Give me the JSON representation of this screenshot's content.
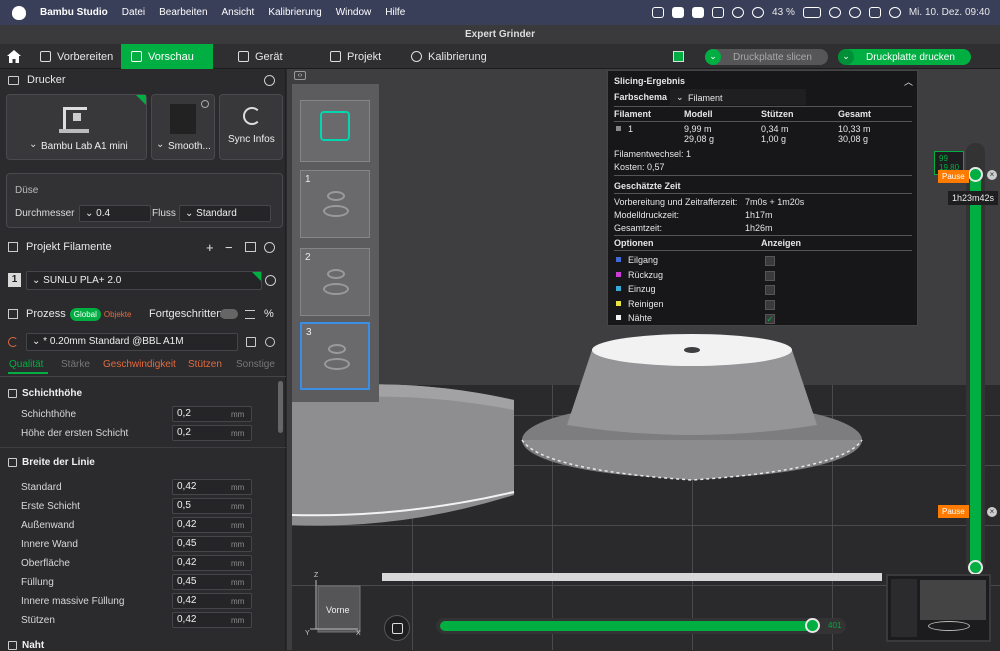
{
  "menubar": {
    "app": "Bambu Studio",
    "items": [
      "Datei",
      "Bearbeiten",
      "Ansicht",
      "Kalibrierung",
      "Window",
      "Hilfe"
    ],
    "battery": "43 %",
    "datetime": "Mi. 10. Dez.  09:40"
  },
  "window_title": "Expert Grinder",
  "nav": {
    "tabs": [
      "Vorbereiten",
      "Vorschau",
      "Gerät",
      "Projekt",
      "Kalibrierung"
    ],
    "active_tab": "Vorschau",
    "slice_button": "Druckplatte slicen",
    "print_button": "Druckplatte drucken"
  },
  "printer": {
    "section_title": "Drucker",
    "printer_name": "Bambu Lab A1 mini",
    "plate_name": "Smooth...",
    "sync_label": "Sync Infos",
    "nozzle_title": "Düse",
    "diameter_label": "Durchmesser",
    "diameter_value": "0.4",
    "flow_label": "Fluss",
    "flow_value": "Standard"
  },
  "filament": {
    "section_title": "Projekt Filamente",
    "slot": "1",
    "name": "SUNLU PLA+ 2.0"
  },
  "process": {
    "title": "Prozess",
    "badge_global": "Global",
    "badge_objects": "Objekte",
    "advanced_label": "Fortgeschritten",
    "preset": "* 0.20mm Standard @BBL A1M",
    "tabs": [
      "Qualität",
      "Stärke",
      "Geschwindigkeit",
      "Stützen",
      "Sonstige"
    ],
    "layer_height_title": "Schichthöhe",
    "layer_rows": [
      {
        "label": "Schichthöhe",
        "value": "0,2",
        "unit": "mm"
      },
      {
        "label": "Höhe der ersten Schicht",
        "value": "0,2",
        "unit": "mm"
      }
    ],
    "line_width_title": "Breite der Linie",
    "line_rows": [
      {
        "label": "Standard",
        "value": "0,42",
        "unit": "mm"
      },
      {
        "label": "Erste Schicht",
        "value": "0,5",
        "unit": "mm"
      },
      {
        "label": "Außenwand",
        "value": "0,42",
        "unit": "mm"
      },
      {
        "label": "Innere Wand",
        "value": "0,45",
        "unit": "mm"
      },
      {
        "label": "Oberfläche",
        "value": "0,42",
        "unit": "mm"
      },
      {
        "label": "Füllung",
        "value": "0,45",
        "unit": "mm"
      },
      {
        "label": "Innere massive Füllung",
        "value": "0,42",
        "unit": "mm"
      },
      {
        "label": "Stützen",
        "value": "0,42",
        "unit": "mm"
      }
    ],
    "seam_title": "Naht"
  },
  "thumbs": [
    "1",
    "2",
    "3"
  ],
  "result": {
    "title": "Slicing-Ergebnis",
    "color_scheme_label": "Farbschema",
    "color_scheme_value": "Filament",
    "headers": [
      "Filament",
      "Modell",
      "Stützen",
      "Gesamt"
    ],
    "row": {
      "id": "1",
      "model_m": "9,99 m",
      "model_g": "29,08 g",
      "support_m": "0,34 m",
      "support_g": "1,00 g",
      "total_m": "10,33 m",
      "total_g": "30,08 g"
    },
    "filament_change": "Filamentwechsel:   1",
    "cost": "Kosten:   0,57",
    "time_title": "Geschätzte Zeit",
    "prep_label": "Vorbereitung und Zeitrafferzeit:",
    "prep_value": "7m0s + 1m20s",
    "model_time_label": "Modelldruckzeit:",
    "model_time_value": "1h17m",
    "total_time_label": "Gesamtzeit:",
    "total_time_value": "1h26m",
    "options_label": "Optionen",
    "show_label": "Anzeigen",
    "options": [
      {
        "name": "Eilgang",
        "color": "#3f6ad8"
      },
      {
        "name": "Rückzug",
        "color": "#c93cd6"
      },
      {
        "name": "Einzug",
        "color": "#39a9d8"
      },
      {
        "name": "Reinigen",
        "color": "#e9e34a"
      },
      {
        "name": "Nähte",
        "color": "#f2f2f2"
      }
    ]
  },
  "layer_slider": {
    "top_value": "99",
    "top_height": "19.80",
    "pause_top": "Pause",
    "time": "1h23m42s",
    "pause_mid": "Pause"
  },
  "bottom": {
    "view_label": "Vorne",
    "axis_z": "Z",
    "axis_y": "Y",
    "axis_x": "X",
    "move_value": "401"
  },
  "colors": {
    "accent": "#00ae42",
    "orange": "#ff7b00",
    "bg": "#2b2b2e"
  }
}
